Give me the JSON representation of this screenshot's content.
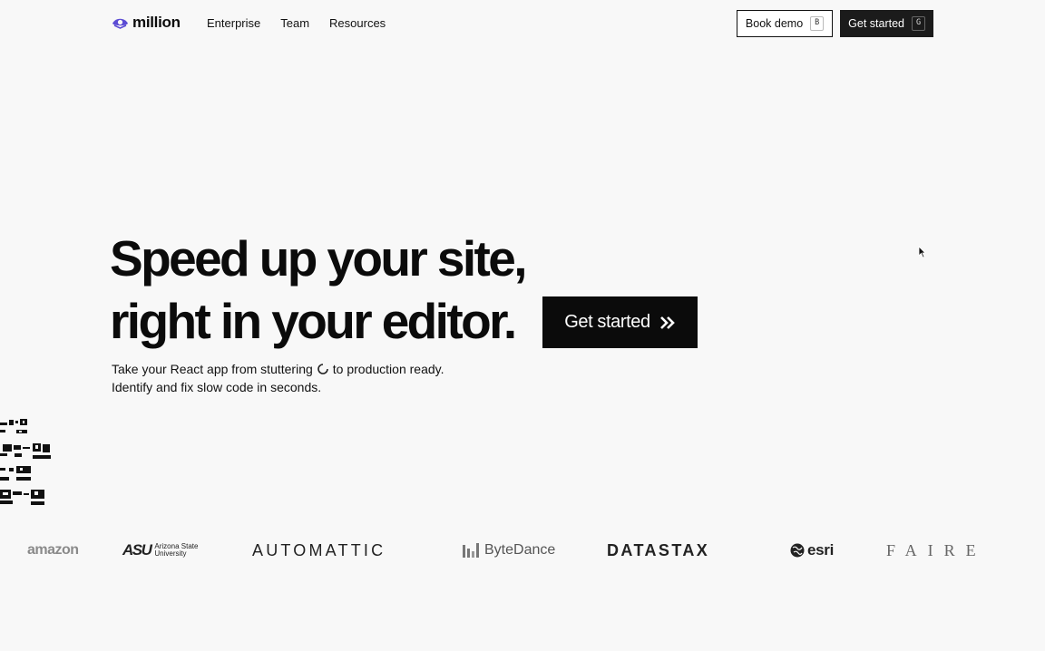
{
  "brand": {
    "name": "million"
  },
  "nav": {
    "links": [
      "Enterprise",
      "Team",
      "Resources"
    ],
    "book_demo": {
      "label": "Book demo",
      "shortcut": "B"
    },
    "get_started": {
      "label": "Get started",
      "shortcut": "G"
    }
  },
  "hero": {
    "line1": "Speed up your site,",
    "line2": "right in your editor.",
    "cta": "Get started",
    "cta_icon": "double-chevron-right-icon",
    "sub_line1_before": "Take your React app from stuttering",
    "sub_line1_after": "to production ready.",
    "sub_line2": "Identify and fix slow code in seconds."
  },
  "logos": {
    "amazon": "amazon",
    "asu_main": "ASU",
    "asu_line1": "Arizona State",
    "asu_line2": "University",
    "automattic": "AUTOMATTIC",
    "bytedance": "ByteDance",
    "datastax": "DATASTAX",
    "esri": "esri",
    "faire": "FAIRE"
  },
  "colors": {
    "brand_accent": "#5b4bd4",
    "cta_bg": "#0b0b0b",
    "page_bg": "#f8f8f8"
  }
}
